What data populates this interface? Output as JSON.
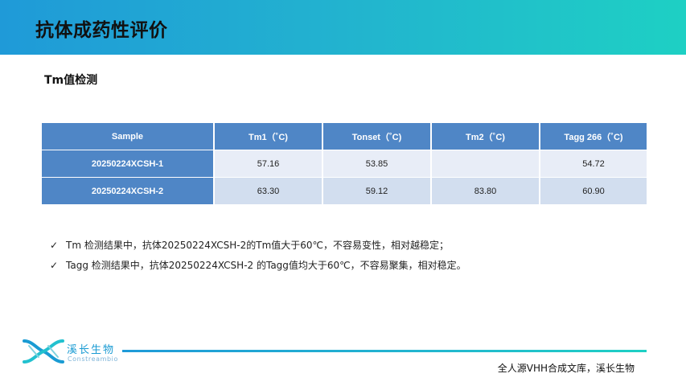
{
  "header": {
    "title": "抗体成药性评价"
  },
  "section": {
    "title": "Tm值检测"
  },
  "table": {
    "columns": [
      "Sample",
      "Tm1（˚C)",
      "Tonset（˚C)",
      "Tm2（˚C)",
      "Tagg 266（˚C)"
    ],
    "rows": [
      {
        "sample": "20250224XCSH-1",
        "tm1": "57.16",
        "tonset": "53.85",
        "tm2": "",
        "tagg": "54.72"
      },
      {
        "sample": "20250224XCSH-2",
        "tm1": "63.30",
        "tonset": "59.12",
        "tm2": "83.80",
        "tagg": "60.90"
      }
    ]
  },
  "bullets": [
    {
      "check": "✓",
      "text": "Tm 检测结果中，抗体20250224XCSH-2的Tm值大于60℃，不容易变性，相对越稳定；"
    },
    {
      "check": "✓",
      "text": "Tagg 检测结果中，抗体20250224XCSH-2 的Tagg值均大于60℃，不容易聚集，相对稳定。"
    }
  ],
  "footer": {
    "logo_cn": "溪长生物",
    "logo_en": "Constreambio",
    "slogan": "全人源VHH合成文库，溪长生物"
  },
  "colors": {
    "header_gradient": [
      "#1f9ad8",
      "#1ed0c4"
    ],
    "table_header": "#4f86c6",
    "row_light": "#e8edf7",
    "row_dark": "#d2deef"
  }
}
